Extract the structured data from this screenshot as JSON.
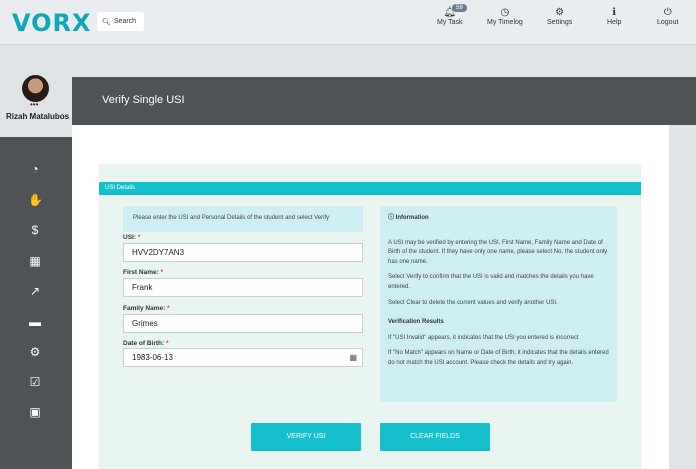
{
  "header": {
    "logo_text": "VORX",
    "search_label": "Search",
    "nav": {
      "my_task": "My Task",
      "my_task_badge": "59",
      "my_timelog": "My Timelog",
      "settings": "Settings",
      "help": "Help",
      "logout": "Logout"
    }
  },
  "profile": {
    "dots": "•••",
    "name": "Rizah Matalubos"
  },
  "page": {
    "title": "Verify Single USI"
  },
  "section": {
    "title": "USI Details"
  },
  "form": {
    "hint": "Please enter the USI and Personal Details of the student and select Verify",
    "usi_label": "USI:",
    "usi_value": "HVV2DY7AN3",
    "first_name_label": "First Name:",
    "first_name_value": "Frank",
    "family_name_label": "Family Name:",
    "family_name_value": "Grimes",
    "dob_label": "Date of Birth:",
    "dob_value": "1983-06-13",
    "required_mark": "*"
  },
  "info": {
    "heading": "Information",
    "p1": "A USI may be verified by entering the USI, First Name, Family Name and Date of Birth of the student. If they have only one name, please select No, the student only has one name.",
    "p2": "Select Verify to confirm that the USI is valid and matches the details you have entered.",
    "p3": "Select Clear to delete the current values and verify another USI.",
    "results_heading": "Verification Results",
    "r1": "If \"USI Invalid\" appears, it indicates that the USI you entered is incorrect",
    "r2": "If \"No Match\" appears on Name or Date of Birth, it indicates that the details entered do not match the USI account. Please check the details and try again."
  },
  "buttons": {
    "verify": "VERIFY USI",
    "clear": "CLEAR FIELDS"
  }
}
